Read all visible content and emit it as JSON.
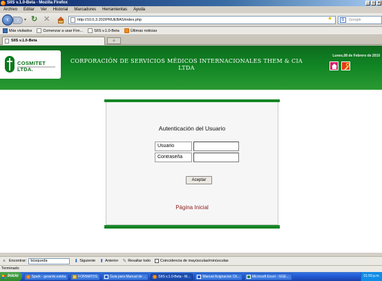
{
  "window": {
    "title": "SIIS v.1.0-Beta - Mozilla Firefox",
    "controls": [
      "_",
      "□",
      "×"
    ]
  },
  "menu": [
    "Archivo",
    "Editar",
    "Ver",
    "Historial",
    "Marcadores",
    "Herramientas",
    "Ayuda"
  ],
  "nav": {
    "url": "http://10.0.3.202/PRUEBAS/index.php",
    "search_placeholder": "Google"
  },
  "bookmarks": [
    {
      "label": "Más visitados",
      "icon": "bookmark-blue-icon"
    },
    {
      "label": "Comenzar a usar Fire...",
      "icon": "page-icon"
    },
    {
      "label": "SIIS v.1.0-Beta",
      "icon": "page-icon"
    },
    {
      "label": "Últimas noticias",
      "icon": "rss-icon"
    }
  ],
  "tabs": [
    {
      "label": "SIIS v.1.0-Beta",
      "active": true
    }
  ],
  "site": {
    "logo_text": "COSMITET LTDA.",
    "title": "CORPORACIÓN DE SERVICIOS MÉDICOS INTERNACIONALES THEM & CIA LTDA",
    "date": "Lunes,08 de Febrero de 2010",
    "colors": {
      "header": "#118424",
      "home_button": "#d6206a",
      "key_button": "#e43a1a",
      "link": "#8b1a1a"
    }
  },
  "login": {
    "heading": "Autenticación del Usuario",
    "user_label": "Usuario",
    "password_label": "Contraseña",
    "submit_label": "Aceptar",
    "home_link": "Página Inicial"
  },
  "findbar": {
    "label": "Encontrar:",
    "value": "búsqueda",
    "next": "Siguiente",
    "previous": "Anterior",
    "highlight": "Resaltar todo",
    "match_case": "Coincidencia de mayúsculas/minúsculas"
  },
  "status": "Terminado",
  "taskbar": {
    "start": "Inicio",
    "tasks": [
      {
        "label": "Spark - gerardo.estela",
        "icon": "ti-fox",
        "active": false
      },
      {
        "label": "FORMATOS",
        "icon": "ti-folder",
        "active": false
      },
      {
        "label": "Guia para Manual de ...",
        "icon": "ti-word",
        "active": false
      },
      {
        "label": "SIIS v.1.0-Beta - M...",
        "icon": "ti-fox",
        "active": true
      },
      {
        "label": "Manual Asignacion Cit...",
        "icon": "ti-word",
        "active": false
      },
      {
        "label": "Microsoft Excel - GGE...",
        "icon": "ti-excel",
        "active": false
      }
    ],
    "clock": "01:59 p.m."
  }
}
